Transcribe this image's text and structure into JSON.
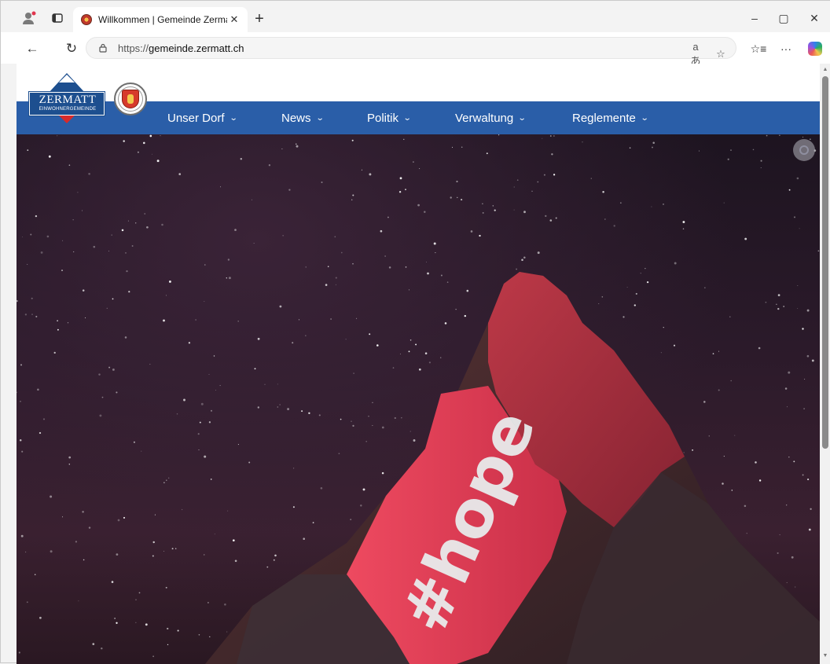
{
  "browser": {
    "tab": {
      "title": "Willkommen | Gemeinde Zermatt",
      "close_glyph": "✕"
    },
    "new_tab_glyph": "+",
    "window_controls": {
      "minimize": "–",
      "maximize": "▢",
      "close": "✕"
    },
    "toolbar": {
      "back_glyph": "←",
      "reload_glyph": "↻",
      "url_scheme": "https://",
      "url_host": "gemeinde.zermatt.ch",
      "read_aloud_glyph": "aあ",
      "favorite_glyph": "☆",
      "favorites_glyph": "☆≡",
      "more_glyph": "···"
    }
  },
  "site": {
    "logo": {
      "title": "ZERMATT",
      "subtitle": "EINWOHNERGEMEINDE"
    },
    "nav": [
      {
        "label": "Unser Dorf",
        "chevron": "⌄"
      },
      {
        "label": "News",
        "chevron": "⌄"
      },
      {
        "label": "Politik",
        "chevron": "⌄"
      },
      {
        "label": "Verwaltung",
        "chevron": "⌄"
      },
      {
        "label": "Reglemente",
        "chevron": "⌄"
      }
    ],
    "hero": {
      "projection_text": "#hope"
    }
  },
  "colors": {
    "nav_bar": "#2a5ea8",
    "logo_blue": "#1d4f8f",
    "projection_red": "#e0354e",
    "sky": "#241722"
  },
  "icons": {
    "profile": "profile-icon",
    "tab_actions": "tab-actions-icon",
    "lock": "site-info-icon",
    "visual_search": "visual-search-icon",
    "copilot": "copilot-icon"
  }
}
